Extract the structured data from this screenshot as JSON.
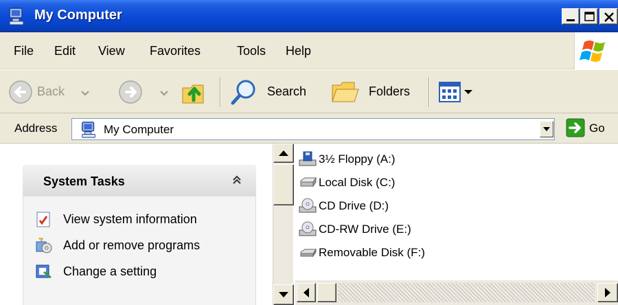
{
  "window": {
    "title": "My Computer"
  },
  "menu": {
    "items": [
      "File",
      "Edit",
      "View",
      "Favorites",
      "Tools",
      "Help"
    ]
  },
  "toolbar": {
    "back_label": "Back",
    "search_label": "Search",
    "folders_label": "Folders"
  },
  "address": {
    "label": "Address",
    "value": "My Computer",
    "go_label": "Go"
  },
  "tasks": {
    "title": "System Tasks",
    "items": [
      {
        "label": "View system information",
        "icon": "system-info-icon"
      },
      {
        "label": "Add or remove programs",
        "icon": "add-remove-programs-icon"
      },
      {
        "label": "Change a setting",
        "icon": "control-panel-icon"
      }
    ]
  },
  "drives": [
    {
      "label": "3½ Floppy (A:)",
      "icon": "floppy-drive-icon"
    },
    {
      "label": "Local Disk (C:)",
      "icon": "hard-disk-icon"
    },
    {
      "label": "CD Drive (D:)",
      "icon": "cd-drive-icon"
    },
    {
      "label": "CD-RW Drive (E:)",
      "icon": "cd-rw-drive-icon"
    },
    {
      "label": "Removable Disk (F:)",
      "icon": "removable-disk-icon"
    }
  ],
  "colors": {
    "titlebar": "#0a49d6",
    "chrome": "#ece9d8",
    "go_green": "#2f9e22"
  }
}
